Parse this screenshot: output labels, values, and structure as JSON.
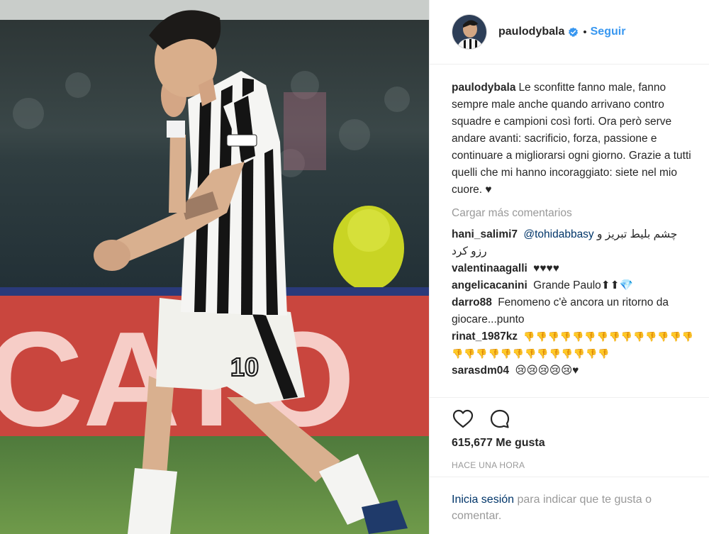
{
  "post": {
    "username": "paulodybala",
    "separator": "•",
    "follow_label": "Seguir",
    "caption": "Le sconfitte fanno male, fanno sempre male anche quando arrivano contro squadre e campioni così forti. Ora però serve andare avanti: sacrificio, forza, passione e continuare a migliorarsi ogni giorno. Grazie a tutti quelli che mi hanno incoraggiato: siete nel mio cuore. ♥",
    "load_more": "Cargar más comentarios",
    "comments": [
      {
        "user": "hani_salimi7",
        "mention": "@tohidabbasy",
        "text": "چشم بلیط تبریز و رزو کرد"
      },
      {
        "user": "valentinaagalli",
        "text": "♥♥♥♥"
      },
      {
        "user": "angelicacanini",
        "text": "Grande Paulo⬆⬆💎"
      },
      {
        "user": "darro88",
        "text": "Fenomeno c'è ancora un ritorno da giocare...punto"
      },
      {
        "user": "rinat_1987kz",
        "text": "👎👎👎👎👎👎👎👎👎👎👎👎👎👎👎👎👎👎👎👎👎👎👎👎👎👎👎"
      },
      {
        "user": "sarasdm04",
        "text": "😢😢😢😢😢♥"
      }
    ],
    "likes": "615,677 Me gusta",
    "timestamp": "HACE UNA HORA",
    "login_link": "Inicia sesión",
    "login_text": "para indicar que te gusta o comentar.",
    "jersey_number": "10"
  },
  "colors": {
    "link": "#3897f0",
    "dark_link": "#003569",
    "verified": "#3897f0",
    "muted": "#999999"
  },
  "icons": [
    "verified-badge-icon",
    "heart-icon",
    "comment-icon"
  ]
}
